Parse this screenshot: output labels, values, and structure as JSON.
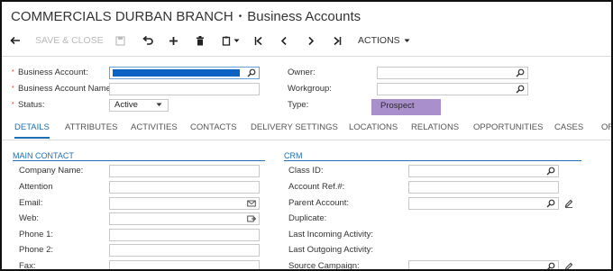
{
  "header": {
    "branch": "COMMERCIALS DURBAN BRANCH",
    "separator": "•",
    "screen_title": "Business Accounts"
  },
  "toolbar": {
    "save_close_label": "SAVE & CLOSE",
    "actions_label": "ACTIONS",
    "icons": [
      "back-arrow-icon",
      "save-icon",
      "undo-icon",
      "plus-icon",
      "trash-icon",
      "copy-paste-icon",
      "first-record-icon",
      "prev-record-icon",
      "next-record-icon",
      "last-record-icon",
      "caret-down-icon"
    ]
  },
  "summary": {
    "business_account_label": "Business Account:",
    "business_account_name_label": "Business Account Name:",
    "status_label": "Status:",
    "status_value": "Active",
    "owner_label": "Owner:",
    "workgroup_label": "Workgroup:",
    "type_label": "Type:",
    "type_value": "Prospect",
    "required_marker": "*"
  },
  "tabs": [
    "DETAILS",
    "ATTRIBUTES",
    "ACTIVITIES",
    "CONTACTS",
    "DELIVERY SETTINGS",
    "LOCATIONS",
    "RELATIONS",
    "OPPORTUNITIES",
    "CASES",
    "OR"
  ],
  "main_contact": {
    "title": "MAIN CONTACT",
    "fields": [
      "Company Name:",
      "Attention",
      "Email:",
      "Web:",
      "Phone 1:",
      "Phone 2:",
      "Fax:"
    ]
  },
  "crm": {
    "title": "CRM",
    "fields": [
      "Class ID:",
      "Account Ref.#:",
      "Parent Account:",
      "Duplicate:",
      "Last Incoming Activity:",
      "Last Outgoing Activity:",
      "Source Campaign:"
    ]
  },
  "colors": {
    "accent": "#1f6fb5",
    "type_badge": "#a98fcc",
    "selection": "#0a62c4",
    "required": "#c0392b"
  }
}
